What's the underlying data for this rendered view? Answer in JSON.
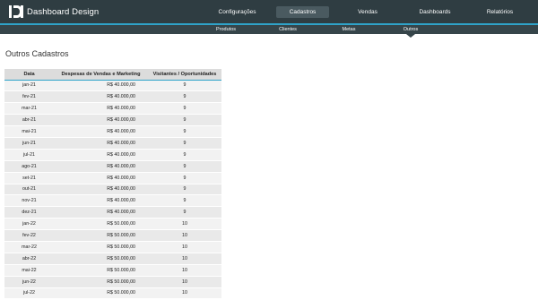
{
  "app": {
    "brand": "Dashboard Design",
    "colors": {
      "topbar": "#2f3d42",
      "accent": "#2fa3c9",
      "subbar": "#36454a"
    }
  },
  "nav": {
    "items": [
      {
        "label": "Configurações",
        "active": false
      },
      {
        "label": "Cadastros",
        "active": true
      },
      {
        "label": "Vendas",
        "active": false
      },
      {
        "label": "Dashboards",
        "active": false
      },
      {
        "label": "Relatórios",
        "active": false
      }
    ]
  },
  "subnav": {
    "items": [
      {
        "label": "Produtos",
        "active": false
      },
      {
        "label": "Clientes",
        "active": false
      },
      {
        "label": "Metas",
        "active": false
      },
      {
        "label": "Outros",
        "active": true
      }
    ]
  },
  "page": {
    "title": "Outros Cadastros"
  },
  "table": {
    "headers": [
      "Data",
      "Despesas de Vendas e Marketing",
      "Visitantes / Oportunidades"
    ],
    "rows": [
      [
        "jan-21",
        "R$ 40.000,00",
        "9"
      ],
      [
        "fev-21",
        "R$ 40.000,00",
        "9"
      ],
      [
        "mar-21",
        "R$ 40.000,00",
        "9"
      ],
      [
        "abr-21",
        "R$ 40.000,00",
        "9"
      ],
      [
        "mai-21",
        "R$ 40.000,00",
        "9"
      ],
      [
        "jun-21",
        "R$ 40.000,00",
        "9"
      ],
      [
        "jul-21",
        "R$ 40.000,00",
        "9"
      ],
      [
        "ago-21",
        "R$ 40.000,00",
        "9"
      ],
      [
        "set-21",
        "R$ 40.000,00",
        "9"
      ],
      [
        "out-21",
        "R$ 40.000,00",
        "9"
      ],
      [
        "nov-21",
        "R$ 40.000,00",
        "9"
      ],
      [
        "dez-21",
        "R$ 40.000,00",
        "9"
      ],
      [
        "jan-22",
        "R$ 50.000,00",
        "10"
      ],
      [
        "fev-22",
        "R$ 50.000,00",
        "10"
      ],
      [
        "mar-22",
        "R$ 50.000,00",
        "10"
      ],
      [
        "abr-22",
        "R$ 50.000,00",
        "10"
      ],
      [
        "mai-22",
        "R$ 50.000,00",
        "10"
      ],
      [
        "jun-22",
        "R$ 50.000,00",
        "10"
      ],
      [
        "jul-22",
        "R$ 50.000,00",
        "10"
      ]
    ]
  }
}
